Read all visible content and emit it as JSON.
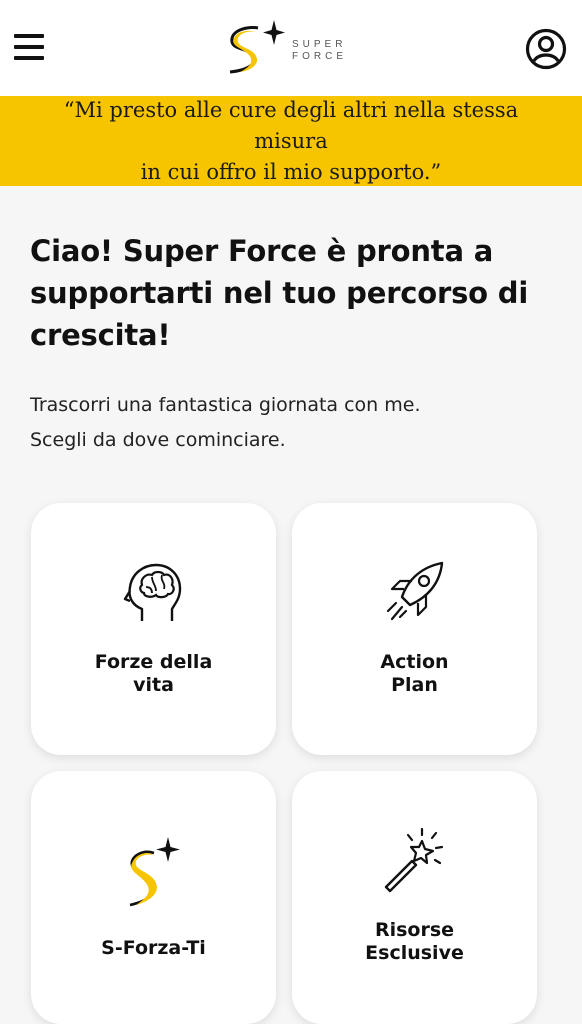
{
  "header": {
    "logo_line1": "SUPER",
    "logo_line2": "FORCE",
    "menu_icon": "hamburger-menu-icon",
    "profile_icon": "user-profile-icon"
  },
  "quote": {
    "line1": "“Mi presto alle cure degli altri nella stessa misura",
    "line2": "in cui offro il mio supporto.”"
  },
  "main": {
    "headline_line1": "Ciao! Super Force è pronta a",
    "headline_line2": "supportarti nel tuo percorso di",
    "headline_line3": "crescita!",
    "sub_line1": "Trascorri una fantastica giornata con me.",
    "sub_line2": "Scegli da dove cominciare."
  },
  "cards": [
    {
      "label_line1": "Forze della",
      "label_line2": "vita",
      "icon": "head-brain-icon"
    },
    {
      "label_line1": "Action",
      "label_line2": "Plan",
      "icon": "rocket-icon"
    },
    {
      "label_line1": "S-Forza-Ti",
      "icon": "super-force-s-logo-icon"
    },
    {
      "label_line1": "Risorse",
      "label_line2": "Esclusive",
      "icon": "magic-wand-icon"
    }
  ],
  "colors": {
    "accent_yellow": "#f7c500",
    "background": "#f6f6f6",
    "card": "#ffffff",
    "text": "#111111"
  }
}
